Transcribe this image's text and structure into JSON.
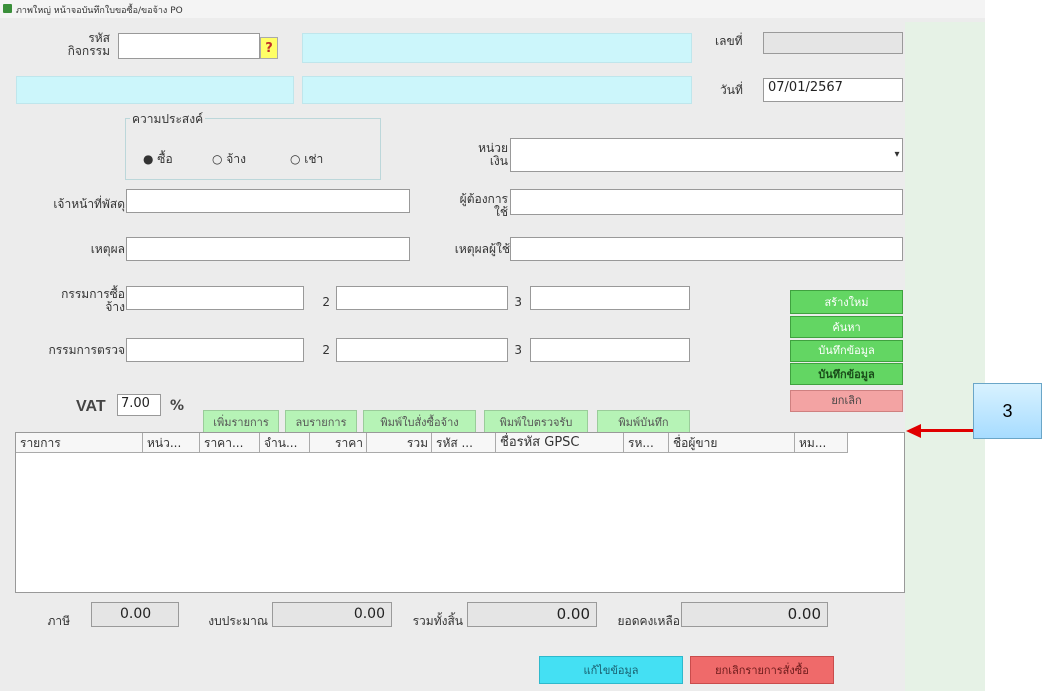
{
  "window": {
    "title": "ภาพใหญ่ หน้าจอบันทึกใบขอซื้อ/ขอจ้าง PO"
  },
  "header": {
    "code_label": "รหัส\nกิจกรรม",
    "question_button": "?",
    "number_label": "เลขที่",
    "number_value": "",
    "date_label": "วันที่",
    "date_value": "07/01/2567"
  },
  "purpose": {
    "title": "ความประสงค์",
    "options": [
      "ซื้อ",
      "จ้าง",
      "เช่า"
    ],
    "selected": "ซื้อ"
  },
  "form": {
    "currency_label": "หน่วย\nเงิน",
    "officer_label": "เจ้าหน้าที่พัสดุ",
    "user_label": "ผู้ต้องการ\nใช้",
    "reason_label": "เหตุผล",
    "usage_reason_label": "เหตุผลผู้ใช้",
    "committee_buy_label": "กรรมการซื้อ\nจ้าง",
    "committee_inspect_label": "กรรมการตรวจ",
    "num2": "2",
    "num3": "3",
    "vat_label": "VAT",
    "vat_value": "7.00",
    "vat_unit": "%"
  },
  "action_buttons": [
    "เพิ่มรายการ",
    "ลบรายการ",
    "พิมพ์ใบสั่งซื้อจ้าง",
    "พิมพ์ใบตรวจรับ",
    "พิมพ์บันทึก"
  ],
  "side_buttons": {
    "new": "สร้างใหม่",
    "search": "ค้นหา",
    "save": "บันทึกข้อมูล",
    "cancel": "ยกเลิก"
  },
  "grid": {
    "columns": [
      "รายการ",
      "หน่ว...",
      "ราคา...",
      "จำน...",
      "ราคา",
      "รวม",
      "รหัส ...",
      "ชื่อรหัส GPSC",
      "รห...",
      "ชื่อผู้ขาย",
      "หม..."
    ]
  },
  "totals": {
    "tax_label": "ภาษี",
    "tax_value": "0.00",
    "budget_label": "งบประมาณ",
    "budget_value": "0.00",
    "total_label": "รวมทั้งสิ้น",
    "total_value": "0.00",
    "remaining_label": "ยอดคงเหลือ",
    "remaining_value": "0.00"
  },
  "bottom_buttons": {
    "edit": "แก้ไขข้อมูล",
    "cancel_item": "ยกเลิกรายการสั่งซื้อ"
  },
  "annotation": {
    "number": "3"
  },
  "colors": {
    "cyan": "#ccf6fb",
    "green": "#b6f3b6",
    "green_dark": "#63d663",
    "red": "#f3a3a3",
    "arrow": "#e00000"
  }
}
